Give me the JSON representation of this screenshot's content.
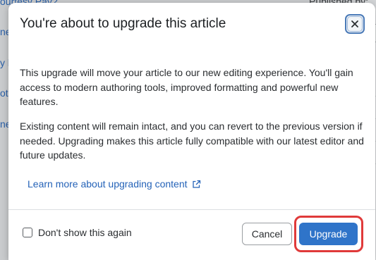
{
  "background": {
    "links": [
      "ourtesy Pay?",
      "ne",
      "y l",
      "ot",
      "ne"
    ],
    "published_label": "Published by:",
    "select_value": "(("
  },
  "modal": {
    "title": "You're about to upgrade this article",
    "paragraph1": "This upgrade will move your article to our new editing experience. You'll gain access to modern authoring tools, improved formatting and powerful new features.",
    "paragraph2": "Existing content will remain intact, and you can revert to the previous version if needed. Upgrading makes this article fully compatible with our latest editor and future updates.",
    "learn_more_link": "Learn more about upgrading content",
    "dont_show_label": "Don't show this again",
    "cancel_label": "Cancel",
    "upgrade_label": "Upgrade",
    "icons": {
      "close": "close-icon",
      "external_link": "external-link-icon",
      "checkbox": "checkbox-unchecked"
    }
  },
  "colors": {
    "primary": "#2f74c9",
    "link": "#2563b8",
    "highlight": "#e03a3a",
    "overlay": "#c9cbcd"
  }
}
